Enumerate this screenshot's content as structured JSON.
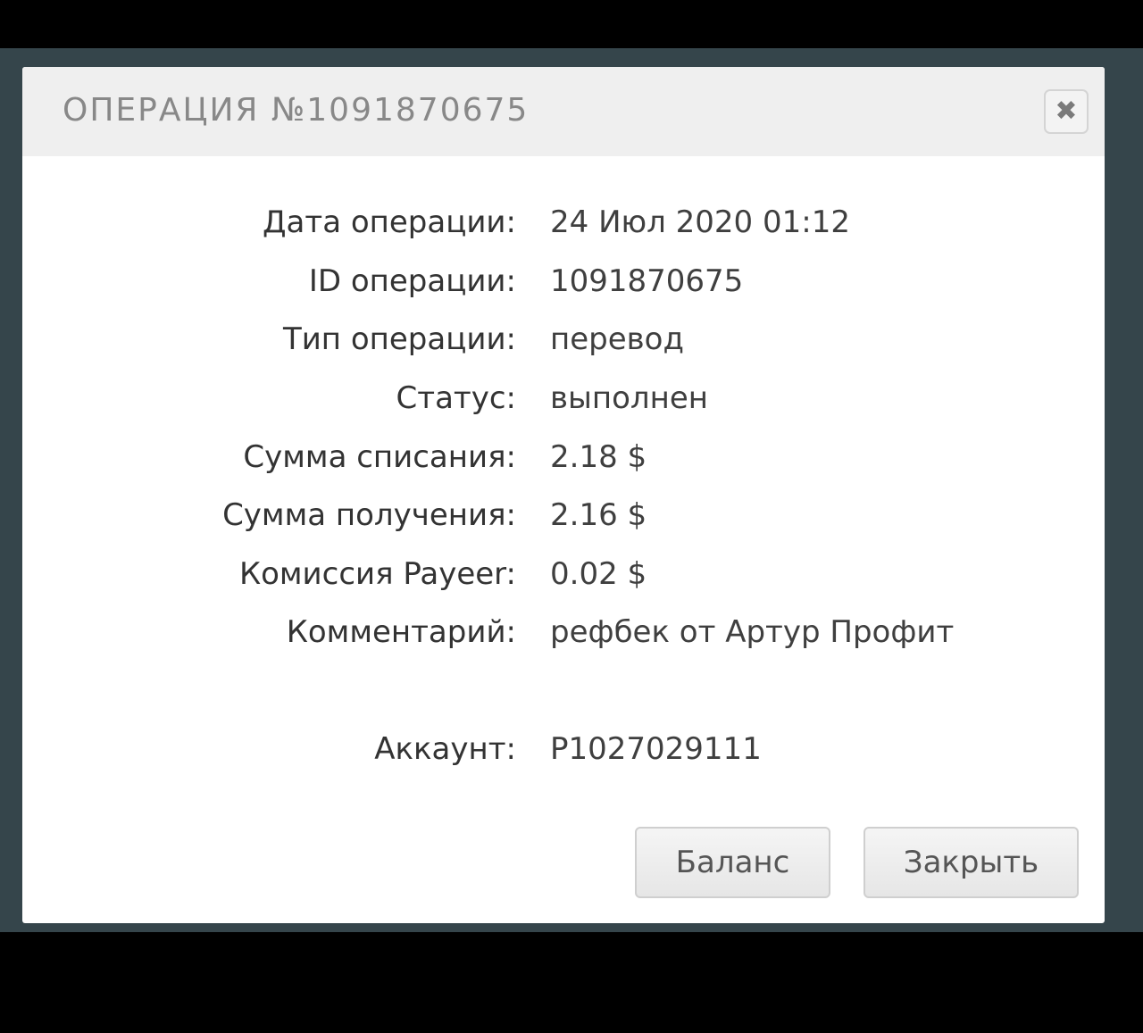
{
  "modal": {
    "title": "ОПЕРАЦИЯ №1091870675",
    "close_icon": "close-icon",
    "close_glyph": "✖",
    "rows": [
      {
        "label": "Дата операции:",
        "value": "24 Июл 2020 01:12"
      },
      {
        "label": "ID операции:",
        "value": "1091870675"
      },
      {
        "label": "Тип операции:",
        "value": "перевод"
      },
      {
        "label": "Статус:",
        "value": "выполнен"
      },
      {
        "label": "Сумма списания:",
        "value": "2.18 $"
      },
      {
        "label": "Сумма получения:",
        "value": "2.16 $"
      },
      {
        "label": "Комиссия Payeer:",
        "value": "0.02 $"
      },
      {
        "label": "Комментарий:",
        "value": "рефбек от Артур Профит"
      },
      {
        "label": "Аккаунт:",
        "value": "P1027029111"
      }
    ],
    "buttons": {
      "balance_label": "Баланс",
      "close_label": "Закрыть"
    }
  },
  "colors": {
    "backdrop": "#35454b",
    "header_bg": "#efefef",
    "title_text": "#888888",
    "body_text": "#333333"
  }
}
